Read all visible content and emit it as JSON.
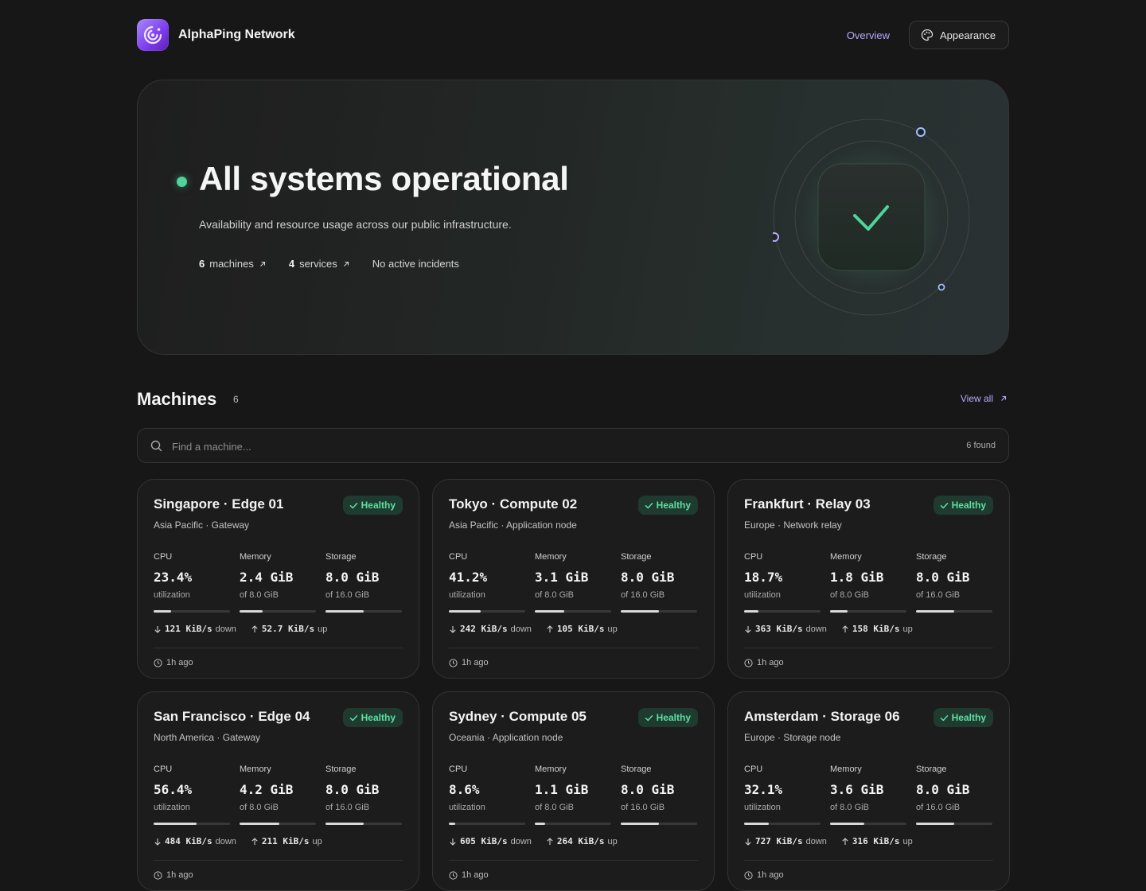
{
  "header": {
    "brand": "AlphaPing Network",
    "nav_overview": "Overview",
    "appearance_label": "Appearance",
    "accent": "#b9a8ff"
  },
  "hero": {
    "title": "All systems operational",
    "subtitle": "Availability and resource usage across our public infrastructure.",
    "machines_count": "6",
    "machines_label": "machines",
    "services_count": "4",
    "services_label": "services",
    "incidents": "No active incidents",
    "status_color": "#4fd49b"
  },
  "machines": {
    "title": "Machines",
    "count": "6",
    "view_all": "View all",
    "search_placeholder": "Find a machine...",
    "found": "6 found",
    "labels": {
      "cpu": "CPU",
      "memory": "Memory",
      "storage": "Storage",
      "cpu_sub": "utilization",
      "down": "down",
      "up": "up"
    },
    "items": [
      {
        "name": "Singapore · Edge 01",
        "location": "Asia Pacific · Gateway",
        "status": "Healthy",
        "cpu": "23.4%",
        "cpu_fill": 0.234,
        "memory": "2.4 GiB",
        "memory_of": "of 8.0 GiB",
        "memory_fill": 0.3,
        "storage": "8.0 GiB",
        "storage_of": "of 16.0 GiB",
        "storage_fill": 0.5,
        "down": "121 KiB/s",
        "up": "52.7 KiB/s",
        "updated": "1h ago"
      },
      {
        "name": "Tokyo · Compute 02",
        "location": "Asia Pacific · Application node",
        "status": "Healthy",
        "cpu": "41.2%",
        "cpu_fill": 0.412,
        "memory": "3.1 GiB",
        "memory_of": "of 8.0 GiB",
        "memory_fill": 0.3875,
        "storage": "8.0 GiB",
        "storage_of": "of 16.0 GiB",
        "storage_fill": 0.5,
        "down": "242 KiB/s",
        "up": "105 KiB/s",
        "updated": "1h ago"
      },
      {
        "name": "Frankfurt · Relay 03",
        "location": "Europe · Network relay",
        "status": "Healthy",
        "cpu": "18.7%",
        "cpu_fill": 0.187,
        "memory": "1.8 GiB",
        "memory_of": "of 8.0 GiB",
        "memory_fill": 0.225,
        "storage": "8.0 GiB",
        "storage_of": "of 16.0 GiB",
        "storage_fill": 0.5,
        "down": "363 KiB/s",
        "up": "158 KiB/s",
        "updated": "1h ago"
      },
      {
        "name": "San Francisco · Edge 04",
        "location": "North America · Gateway",
        "status": "Healthy",
        "cpu": "56.4%",
        "cpu_fill": 0.564,
        "memory": "4.2 GiB",
        "memory_of": "of 8.0 GiB",
        "memory_fill": 0.525,
        "storage": "8.0 GiB",
        "storage_of": "of 16.0 GiB",
        "storage_fill": 0.5,
        "down": "484 KiB/s",
        "up": "211 KiB/s",
        "updated": "1h ago"
      },
      {
        "name": "Sydney · Compute 05",
        "location": "Oceania · Application node",
        "status": "Healthy",
        "cpu": "8.6%",
        "cpu_fill": 0.086,
        "memory": "1.1 GiB",
        "memory_of": "of 8.0 GiB",
        "memory_fill": 0.1375,
        "storage": "8.0 GiB",
        "storage_of": "of 16.0 GiB",
        "storage_fill": 0.5,
        "down": "605 KiB/s",
        "up": "264 KiB/s",
        "updated": "1h ago"
      },
      {
        "name": "Amsterdam · Storage 06",
        "location": "Europe · Storage node",
        "status": "Healthy",
        "cpu": "32.1%",
        "cpu_fill": 0.321,
        "memory": "3.6 GiB",
        "memory_of": "of 8.0 GiB",
        "memory_fill": 0.45,
        "storage": "8.0 GiB",
        "storage_of": "of 16.0 GiB",
        "storage_fill": 0.5,
        "down": "727 KiB/s",
        "up": "316 KiB/s",
        "updated": "1h ago"
      }
    ]
  }
}
